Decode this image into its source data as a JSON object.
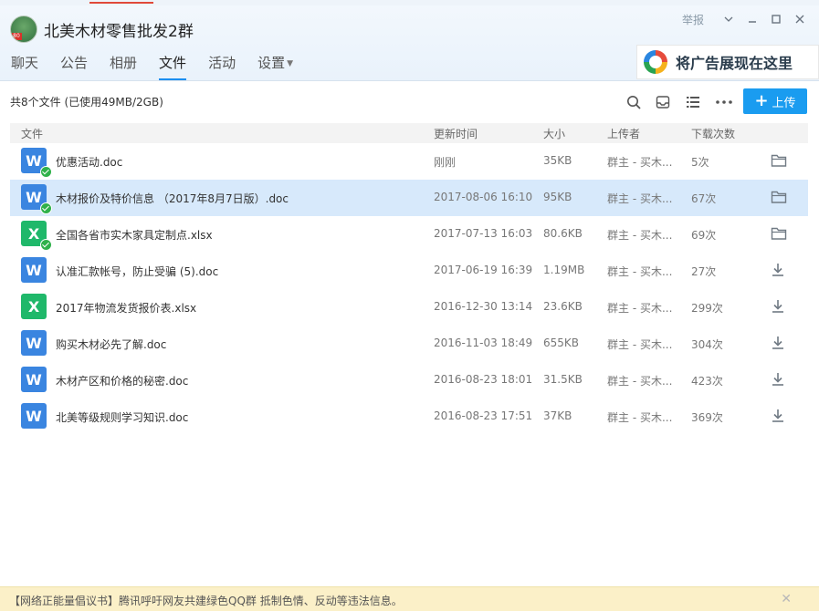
{
  "window": {
    "group_title": "北美木材零售批发2群",
    "report_label": "举报",
    "avatar_badge": "80"
  },
  "tabs": [
    {
      "label": "聊天"
    },
    {
      "label": "公告"
    },
    {
      "label": "相册"
    },
    {
      "label": "文件",
      "active": true
    },
    {
      "label": "活动"
    },
    {
      "label": "设置"
    }
  ],
  "ad": {
    "text": "将广告展现在这里"
  },
  "toolbar": {
    "summary": "共8个文件 (已使用49MB/2GB)",
    "upload_label": "上传",
    "accent_color": "#1a9cf0"
  },
  "table": {
    "headers": {
      "name": "文件",
      "time": "更新时间",
      "size": "大小",
      "uploader": "上传者",
      "downloads": "下载次数"
    },
    "rows": [
      {
        "icon": "W",
        "type": "doc",
        "name": "优惠活动.doc",
        "time": "刚刚",
        "size": "35KB",
        "uploader": "群主 - 买木...",
        "downloads": "5次",
        "checked": true,
        "action": "folder-icon"
      },
      {
        "icon": "W",
        "type": "doc",
        "name": "木材报价及特价信息 （2017年8月7日版）.doc",
        "time": "2017-08-06 16:10",
        "size": "95KB",
        "uploader": "群主 - 买木...",
        "downloads": "67次",
        "checked": true,
        "action": "folder-icon",
        "selected": true
      },
      {
        "icon": "X",
        "type": "xlsx",
        "name": "全国各省市实木家具定制点.xlsx",
        "time": "2017-07-13 16:03",
        "size": "80.6KB",
        "uploader": "群主 - 买木...",
        "downloads": "69次",
        "checked": true,
        "action": "folder-icon"
      },
      {
        "icon": "W",
        "type": "doc",
        "name": "认准汇款帐号，防止受骗 (5).doc",
        "time": "2017-06-19 16:39",
        "size": "1.19MB",
        "uploader": "群主 - 买木...",
        "downloads": "27次",
        "checked": false,
        "action": "download-icon"
      },
      {
        "icon": "X",
        "type": "xlsx",
        "name": "2017年物流发货报价表.xlsx",
        "time": "2016-12-30 13:14",
        "size": "23.6KB",
        "uploader": "群主 - 买木...",
        "downloads": "299次",
        "checked": false,
        "action": "download-icon"
      },
      {
        "icon": "W",
        "type": "doc",
        "name": "购买木材必先了解.doc",
        "time": "2016-11-03 18:49",
        "size": "655KB",
        "uploader": "群主 - 买木...",
        "downloads": "304次",
        "checked": false,
        "action": "download-icon"
      },
      {
        "icon": "W",
        "type": "doc",
        "name": "木材产区和价格的秘密.doc",
        "time": "2016-08-23 18:01",
        "size": "31.5KB",
        "uploader": "群主 - 买木...",
        "downloads": "423次",
        "checked": false,
        "action": "download-icon"
      },
      {
        "icon": "W",
        "type": "doc",
        "name": "北美等级规则学习知识.doc",
        "time": "2016-08-23 17:51",
        "size": "37KB",
        "uploader": "群主 - 买木...",
        "downloads": "369次",
        "checked": false,
        "action": "download-icon"
      }
    ]
  },
  "notice": {
    "text": "【网络正能量倡议书】腾讯呼吁网友共建绿色QQ群 抵制色情、反动等违法信息。"
  }
}
